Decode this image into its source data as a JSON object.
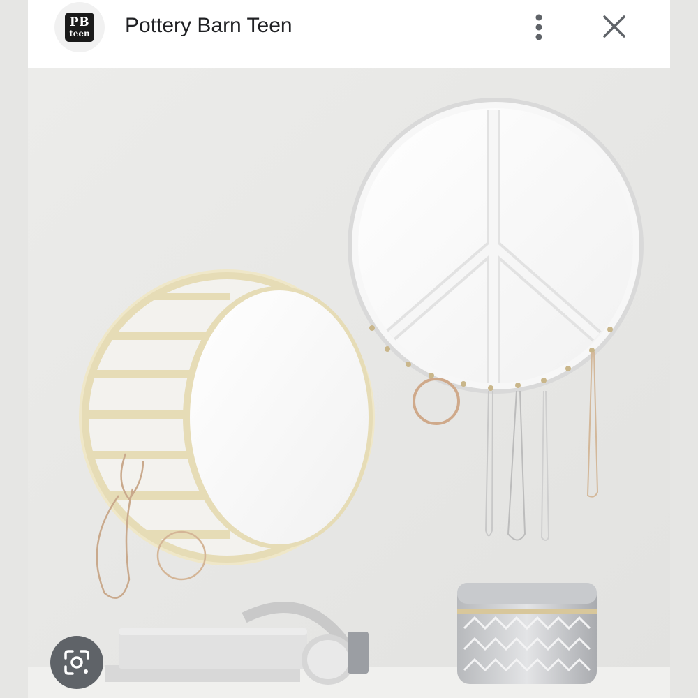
{
  "header": {
    "logo_line1": "PB",
    "logo_line2": "teen",
    "title": "Pottery Barn Teen",
    "more_icon": "more-vert-icon",
    "close_icon": "close-icon"
  },
  "photo": {
    "accent_gold": "#e6dcb6",
    "wall_color": "#e9e9e7"
  },
  "lens_button": {
    "icon": "lens-search-icon",
    "color": "#5f6368"
  }
}
